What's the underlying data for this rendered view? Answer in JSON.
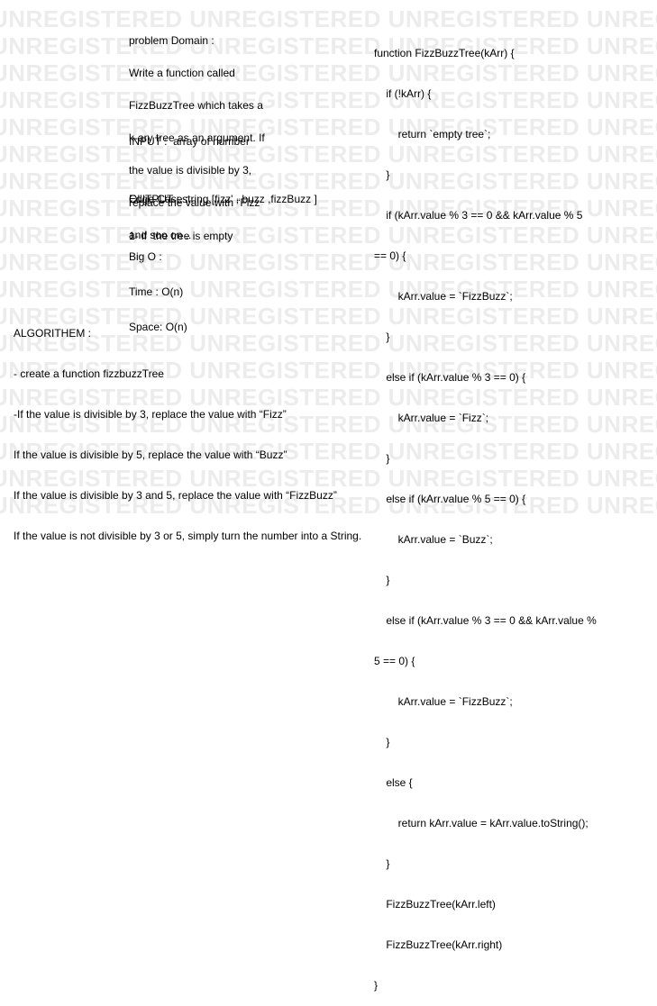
{
  "watermark": {
    "text": "UNREGISTERED UNREGISTERED UNREGISTERED UNREGISTERED"
  },
  "problem": {
    "title": "problem Domain :",
    "desc": [
      "Write a function called",
      "FizzBuzzTree which takes a",
      "k-ary tree as an argument. If",
      "the value is divisible by 3,",
      "replace the value with “Fizz",
      "and soo on .."
    ]
  },
  "io": {
    "input": "INPUT :  array of number",
    "output": "OUTPUT : string [fizz' , buzz ,fizzBuzz ]"
  },
  "edge": {
    "title": "Edge Case :",
    "item": "1- if  the tree is empty"
  },
  "bigo": {
    "title": "Big O :",
    "time": "Time : O(n)",
    "space": "Space: O(n)"
  },
  "algorithm": {
    "title": "ALGORITHEM :",
    "steps": [
      "- create a function fizzbuzzTree",
      "-If the value is divisible by 3, replace the value with “Fizz”",
      "If the value is divisible by 5, replace the value with “Buzz”",
      "If the value is divisible by 3 and 5, replace the value with “FizzBuzz”",
      "If the value is not divisible by 3 or 5, simply turn the number into a String."
    ]
  },
  "code": {
    "lines": [
      "function FizzBuzzTree(kArr) {",
      "    if (!kArr) {",
      "        return `empty tree`;",
      "    }",
      "    if (kArr.value % 3 == 0 && kArr.value % 5",
      "== 0) {",
      "        kArr.value = `FizzBuzz`;",
      "    }",
      "    else if (kArr.value % 3 == 0) {",
      "        kArr.value = `Fizz`;",
      "    }",
      "    else if (kArr.value % 5 == 0) {",
      "        kArr.value = `Buzz`;",
      "    }",
      "    else if (kArr.value % 3 == 0 && kArr.value %",
      "5 == 0) {",
      "        kArr.value = `FizzBuzz`;",
      "    }",
      "    else {",
      "        return kArr.value = kArr.value.toString();",
      "    }",
      "    FizzBuzzTree(kArr.left)",
      "    FizzBuzzTree(kArr.right)",
      "}"
    ]
  }
}
